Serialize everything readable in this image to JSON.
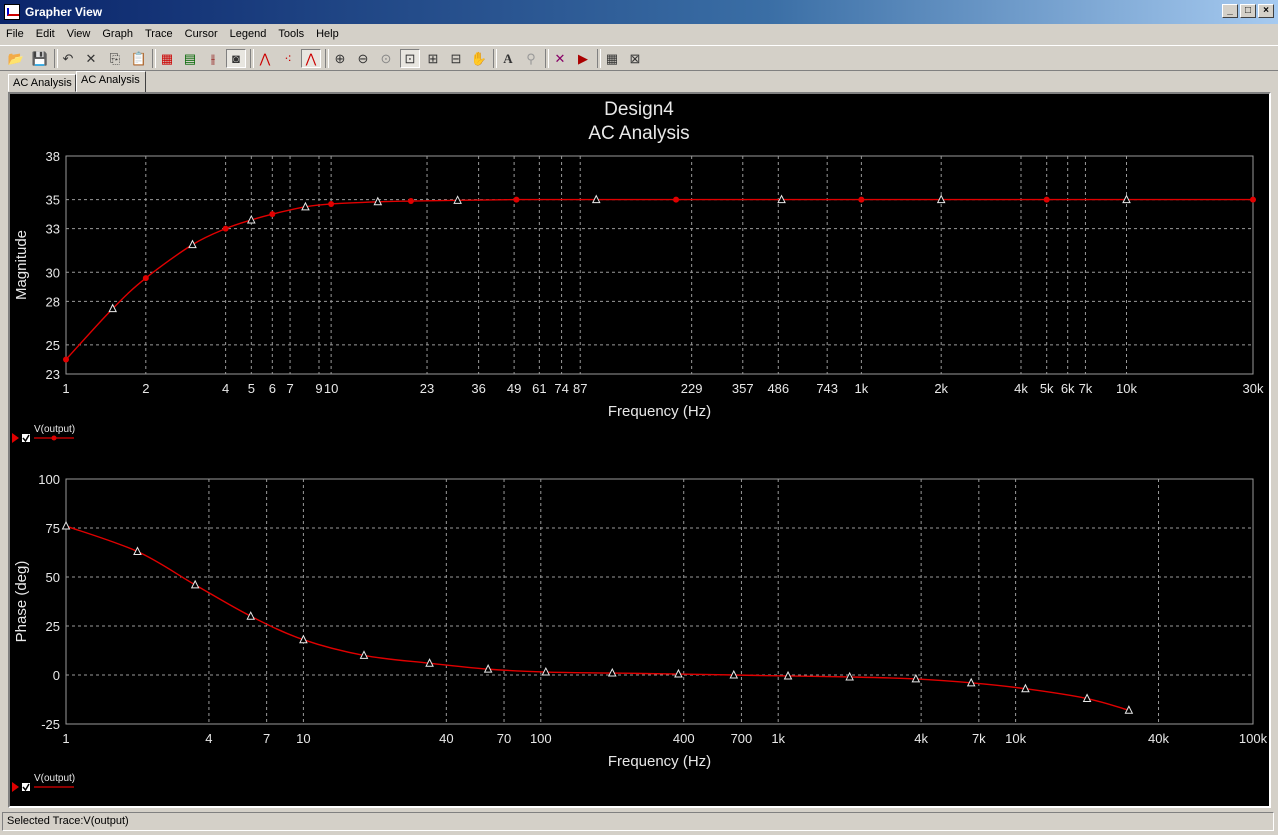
{
  "window": {
    "title": "Grapher View"
  },
  "menu": [
    "File",
    "Edit",
    "View",
    "Graph",
    "Trace",
    "Cursor",
    "Legend",
    "Tools",
    "Help"
  ],
  "tabs": [
    "AC Analysis",
    "AC Analysis"
  ],
  "graph": {
    "title": "Design4",
    "subtitle": "AC Analysis"
  },
  "status": "Selected Trace:V(output)",
  "colors": {
    "trace": "#e00000",
    "grid": "#9a9a9a",
    "background": "#000000",
    "text": "#e8e8e8"
  },
  "chart_data": [
    {
      "type": "line",
      "xlabel": "Frequency (Hz)",
      "ylabel": "Magnitude",
      "xscale": "log",
      "xlim": [
        1,
        30000
      ],
      "ylim": [
        23,
        38
      ],
      "grid": true,
      "legend_position": "bottom-left",
      "yticks": [
        "23",
        "25",
        "28",
        "30",
        "33",
        "35",
        "38"
      ],
      "xticks": [
        "1",
        "2",
        "4",
        "5",
        "6",
        "7",
        "9",
        "10",
        "23",
        "36",
        "49",
        "61",
        "74",
        "87",
        "229",
        "357",
        "486",
        "743",
        "1k",
        "2k",
        "4k",
        "5k",
        "6k",
        "7k",
        "10k",
        "30k"
      ],
      "series": [
        {
          "name": "V(output)",
          "x": [
            1,
            1.5,
            2,
            3,
            4,
            5,
            6,
            8,
            10,
            15,
            20,
            30,
            50,
            100,
            200,
            500,
            1000,
            2000,
            5000,
            10000,
            30000
          ],
          "y": [
            24,
            27.5,
            29.6,
            31.9,
            33.0,
            33.6,
            34.0,
            34.5,
            34.7,
            34.85,
            34.9,
            34.95,
            35,
            35,
            35,
            35,
            35,
            35,
            35,
            35,
            35
          ]
        }
      ]
    },
    {
      "type": "line",
      "xlabel": "Frequency (Hz)",
      "ylabel": "Phase (deg)",
      "xscale": "log",
      "xlim": [
        1,
        100000
      ],
      "ylim": [
        -25,
        100
      ],
      "grid": true,
      "legend_position": "bottom-left",
      "yticks": [
        "-25",
        "0",
        "25",
        "50",
        "75",
        "100"
      ],
      "xticks": [
        "1",
        "4",
        "7",
        "10",
        "40",
        "70",
        "100",
        "400",
        "700",
        "1k",
        "4k",
        "7k",
        "10k",
        "40k",
        "100k"
      ],
      "series": [
        {
          "name": "V(output)",
          "x": [
            1,
            2,
            3.5,
            6,
            10,
            18,
            34,
            60,
            105,
            200,
            380,
            650,
            1100,
            2000,
            3800,
            6500,
            11000,
            20000,
            30000
          ],
          "y": [
            76,
            63,
            46,
            30,
            18,
            10,
            6,
            3,
            1.5,
            1,
            0.5,
            0,
            -0.5,
            -1,
            -2,
            -4,
            -7,
            -12,
            -18
          ]
        }
      ]
    }
  ]
}
